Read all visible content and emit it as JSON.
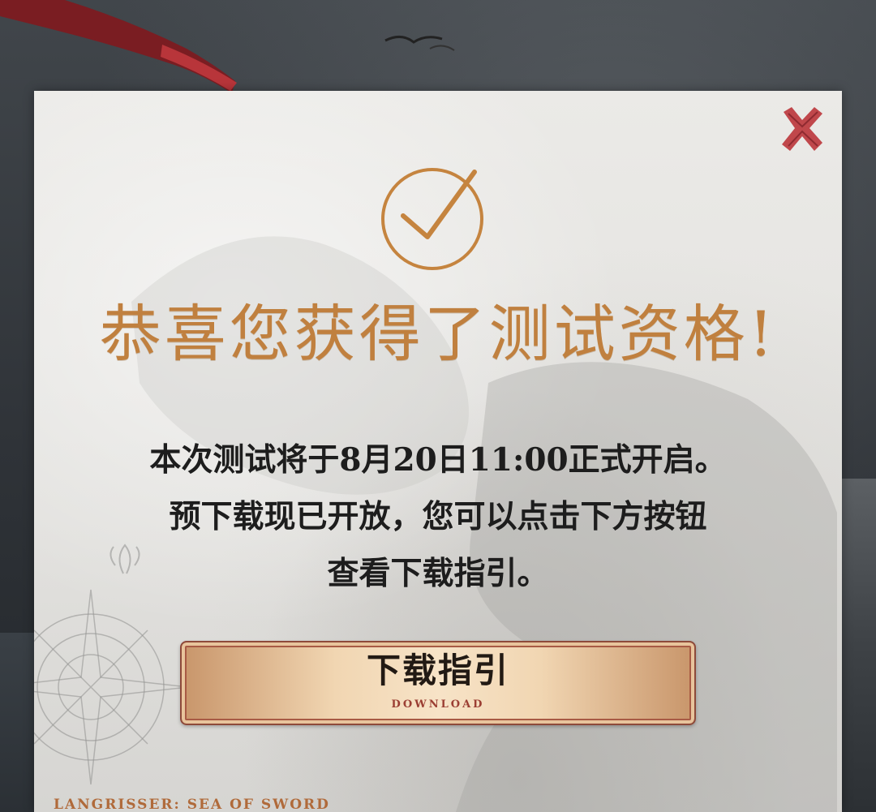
{
  "modal": {
    "title": "恭喜您获得了测试资格!",
    "message_lines": [
      "本次测试将于8月20日11:00正式开启。",
      "预下载现已开放，您可以点击下方按钮",
      "查看下载指引。"
    ],
    "close_icon": "close-x-icon",
    "check_icon": "check-circle-icon",
    "download_button": {
      "label": "下载指引",
      "sublabel": "DOWNLOAD"
    },
    "footer_brand": "LANGRISSER: SEA OF SWORD"
  },
  "colors": {
    "title_gold": "#c0803f",
    "close_red": "#c0474b",
    "button_border": "#8e4a3a",
    "body_text": "#1d1d1d"
  }
}
